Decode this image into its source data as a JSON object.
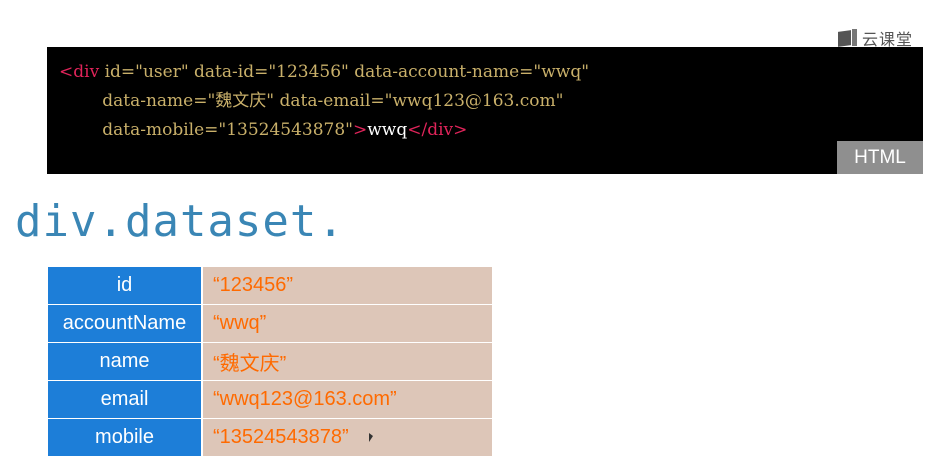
{
  "logo": {
    "text": "云课堂"
  },
  "code": {
    "line1": [
      {
        "t": "tag",
        "v": "<div "
      },
      {
        "t": "attr",
        "v": "id=\"user\" data-id=\"123456\" data-account-name=\"wwq\""
      }
    ],
    "line2": [
      {
        "t": "attr",
        "v": "        data-name=\"魏文庆\" data-email=\"wwq123@163.com\""
      }
    ],
    "line3": [
      {
        "t": "attr",
        "v": "        data-mobile=\"13524543878\""
      },
      {
        "t": "tag",
        "v": ">"
      },
      {
        "t": "text",
        "v": "wwq"
      },
      {
        "t": "tag",
        "v": "</div>"
      }
    ]
  },
  "badge": "HTML",
  "heading": "div.dataset.",
  "table": {
    "rows": [
      {
        "key": "id",
        "value": "“123456”"
      },
      {
        "key": "accountName",
        "value": "“wwq”"
      },
      {
        "key": "name",
        "value": "“魏文庆”"
      },
      {
        "key": "email",
        "value": "“wwq123@163.com”"
      },
      {
        "key": "mobile",
        "value": "“13524543878”"
      }
    ]
  }
}
